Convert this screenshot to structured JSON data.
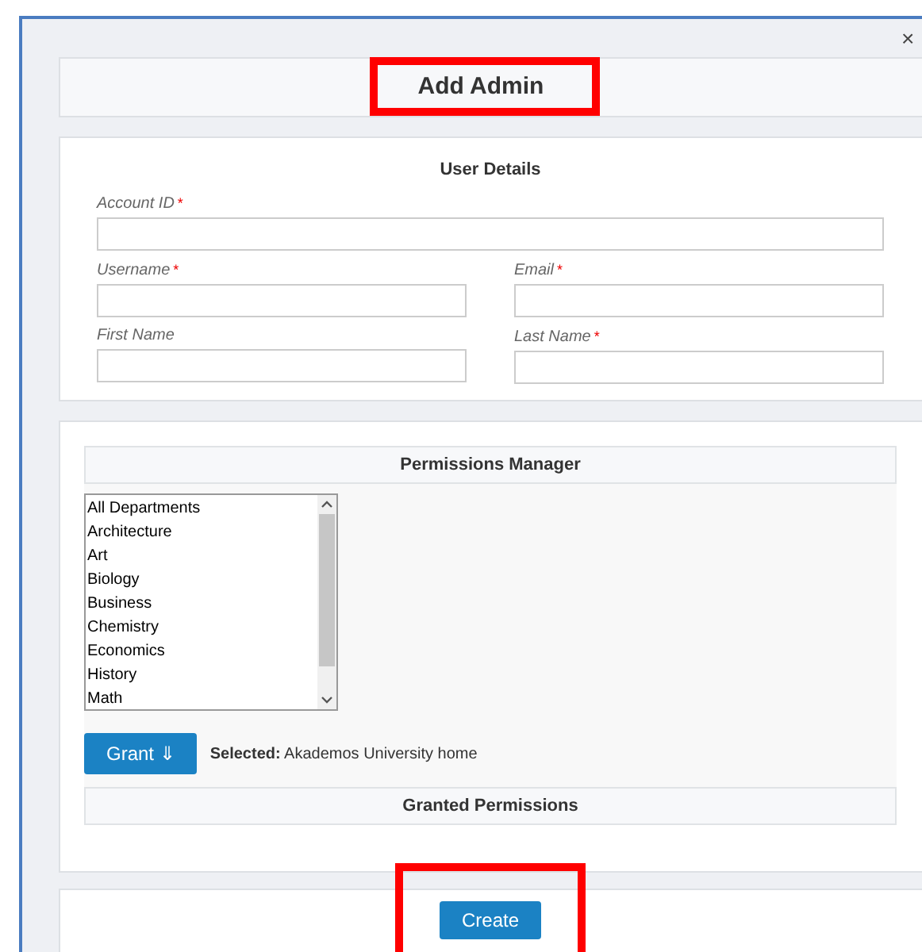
{
  "dialog": {
    "close": "×",
    "title": "Add Admin",
    "title_highlighted": true
  },
  "user_details": {
    "heading": "User Details",
    "fields": [
      {
        "label": "Account ID",
        "required_mark": "*",
        "kind": "wide"
      },
      {
        "label": "Username",
        "required_mark": "*",
        "kind": "half"
      },
      {
        "label": "Email",
        "required_mark": "*",
        "kind": "half"
      },
      {
        "label": "First Name",
        "kind": "half"
      },
      {
        "label": "Last Name",
        "required_mark": "*",
        "kind": "half"
      }
    ]
  },
  "permissions_manager": {
    "heading": "Permissions Manager",
    "departments": [
      {
        "name": "All Departments"
      },
      {
        "name": "Architecture"
      },
      {
        "name": "Art"
      },
      {
        "name": "Biology"
      },
      {
        "name": "Business"
      },
      {
        "name": "Chemistry"
      },
      {
        "name": "Economics"
      },
      {
        "name": "History"
      },
      {
        "name": "Math"
      }
    ],
    "grant_button": "Grant ⇓",
    "selected_text": "**Selected:** Akademos University home",
    "granted_heading": "Granted Permissions"
  },
  "create_button": {
    "label": "Create",
    "highlighted": true
  }
}
